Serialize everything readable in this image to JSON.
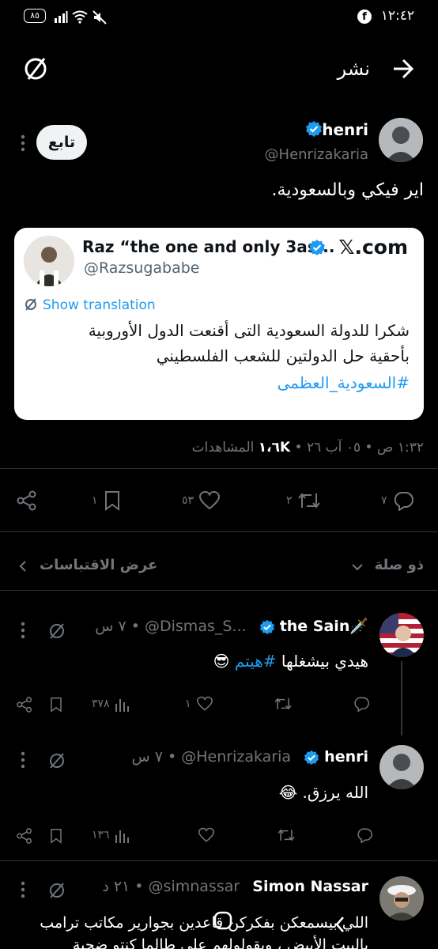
{
  "status_bar": {
    "time": "١٢:٤٢",
    "battery": "٨٥"
  },
  "header": {
    "title": "نشر"
  },
  "tweet": {
    "name": "henri",
    "handle": "@Henrizakaria",
    "follow_label": "تابع",
    "text": "اير فيكي وبالسعودية.",
    "quote": {
      "name": "Raz “the one and only 3as...",
      "handle": "@Razsugababe",
      "source": "𝕏.com",
      "translate_label": "Show translation",
      "line1": "شكرا للدولة السعودية التى أقنعت الدول الأوروبية",
      "line2": "بأحقية حل الدولتين للشعب الفلسطيني",
      "hashtag": "#السعودية_العظمى"
    },
    "meta_time": "١:٣٢ ص • ٠٥ آب ٢٦",
    "views_count": "١،٦K",
    "views_label": "المشاهدات",
    "actions": {
      "replies": "٧",
      "reposts": "٢",
      "likes": "٥٣",
      "bookmarks": "١"
    }
  },
  "quotes_bar": {
    "sort_label": "ذو صلة",
    "quotes_label": "عرض الاقتباسات"
  },
  "replies": [
    {
      "name": "the Sain🗡️",
      "handle": "@Dismas_S...",
      "time": "٧ س",
      "text_main": "هيدي بيشغلها ",
      "hashtag": "#هيتم",
      "emoji": "😎",
      "replies": "",
      "reposts": "",
      "likes": "١",
      "views": "٣٧٨"
    },
    {
      "name": "henri",
      "handle": "@Henrizakaria",
      "time": "٧ س",
      "text_main": "الله يرزق. ",
      "emoji": "😂",
      "replies": "",
      "reposts": "",
      "likes": "",
      "views": "١٣٦"
    },
    {
      "name": "Simon Nassar",
      "handle": "@simnassar",
      "time": "٢١ د",
      "text_line1": "اللي بيسمعكن بفكركن قاعدين بجوارير مكاتب ترامب",
      "text_line2": "بالبيت الأبيض ، ويقولولهم على طالما كنتو ضحية"
    }
  ],
  "colors": {
    "accent": "#1d9bf0",
    "background": "#000000",
    "muted": "#71767b",
    "card": "#ffffff"
  }
}
